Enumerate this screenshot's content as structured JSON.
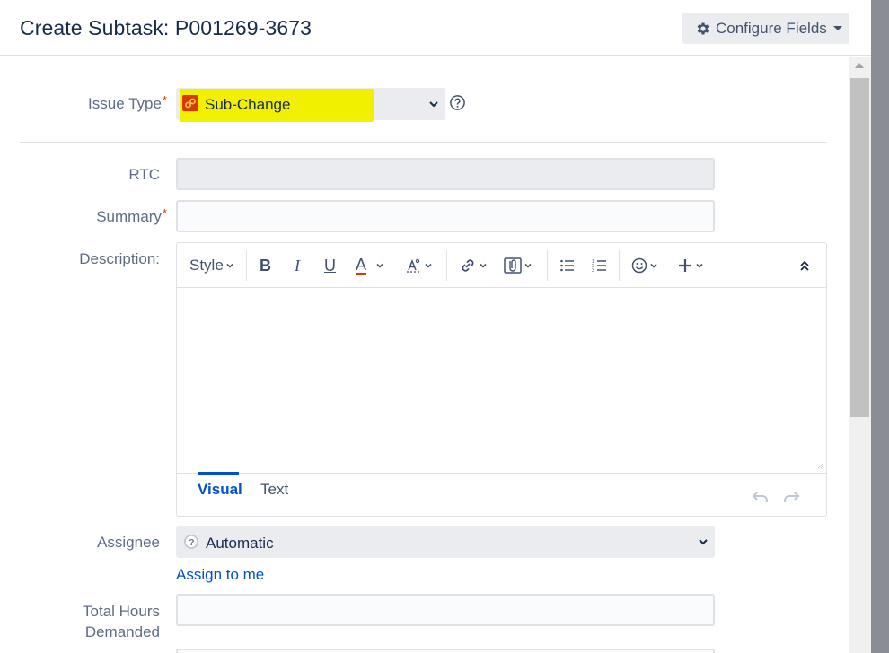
{
  "dialog": {
    "title": "Create Subtask: P001269-3673",
    "configure_fields_label": "Configure Fields"
  },
  "form": {
    "issue_type": {
      "label": "Issue Type",
      "required_mark": "*",
      "value": "Sub-Change"
    },
    "rtc": {
      "label": "RTC",
      "value": ""
    },
    "summary": {
      "label": "Summary",
      "required_mark": "*",
      "value": ""
    },
    "description": {
      "label": "Description:",
      "toolbar": {
        "style_label": "Style",
        "bold": "B",
        "italic": "I",
        "underline": "U",
        "text_color": "A"
      },
      "tabs": {
        "visual": "Visual",
        "text": "Text"
      },
      "value": ""
    },
    "assignee": {
      "label": "Assignee",
      "value": "Automatic",
      "assign_to_me": "Assign to me"
    },
    "total_hours": {
      "label_line1": "Total Hours",
      "label_line2": "Demanded",
      "value": ""
    }
  },
  "colors": {
    "highlight": "#f0f000",
    "link": "#0052cc",
    "required": "#de350b",
    "issue_icon": "#de350b"
  },
  "icons": [
    "gear-icon",
    "caret-down-icon",
    "sub-change-icon",
    "chevron-down-icon",
    "help-icon",
    "bold-icon",
    "italic-icon",
    "underline-icon",
    "text-color-icon",
    "clear-format-icon",
    "link-icon",
    "attachment-icon",
    "bullet-list-icon",
    "numbered-list-icon",
    "emoji-icon",
    "plus-icon",
    "collapse-icon",
    "undo-icon",
    "redo-icon",
    "automatic-avatar-icon"
  ]
}
